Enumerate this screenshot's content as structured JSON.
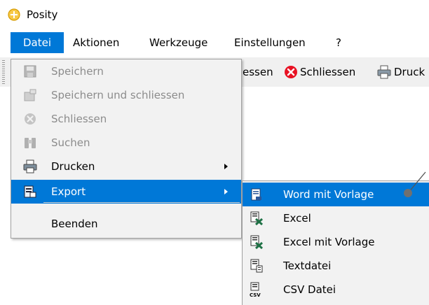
{
  "window": {
    "title": "Posity"
  },
  "menubar": {
    "items": [
      {
        "label": "Datei"
      },
      {
        "label": "Aktionen"
      },
      {
        "label": "Werkzeuge"
      },
      {
        "label": "Einstellungen"
      },
      {
        "label": "?"
      }
    ]
  },
  "toolbar": {
    "partial_left_label": "essen",
    "close_label": "Schliessen",
    "print_label": "Druck"
  },
  "datei_menu": {
    "items": [
      {
        "label": "Speichern",
        "icon": "save-icon",
        "enabled": false
      },
      {
        "label": "Speichern und schliessen",
        "icon": "save-close-icon",
        "enabled": false
      },
      {
        "label": "Schliessen",
        "icon": "close-icon",
        "enabled": false
      },
      {
        "label": "Suchen",
        "icon": "binoculars-icon",
        "enabled": false
      },
      {
        "label": "Drucken",
        "icon": "printer-icon",
        "enabled": true,
        "submenu": true
      },
      {
        "label": "Export",
        "icon": "export-icon",
        "enabled": true,
        "submenu": true,
        "highlighted": true
      },
      {
        "label": "Beenden",
        "enabled": true
      }
    ]
  },
  "export_submenu": {
    "items": [
      {
        "label": "Word mit Vorlage",
        "icon": "word-doc-icon",
        "highlighted": true
      },
      {
        "label": "Excel",
        "icon": "excel-icon"
      },
      {
        "label": "Excel mit Vorlage",
        "icon": "excel-template-icon"
      },
      {
        "label": "Textdatei",
        "icon": "text-file-icon"
      },
      {
        "label": "CSV Datei",
        "icon": "csv-file-icon"
      }
    ]
  },
  "colors": {
    "highlight": "#0078d7",
    "disabled_text": "#8c8c8c",
    "menu_bg": "#f2f2f2",
    "close_icon_red": "#e81123"
  }
}
